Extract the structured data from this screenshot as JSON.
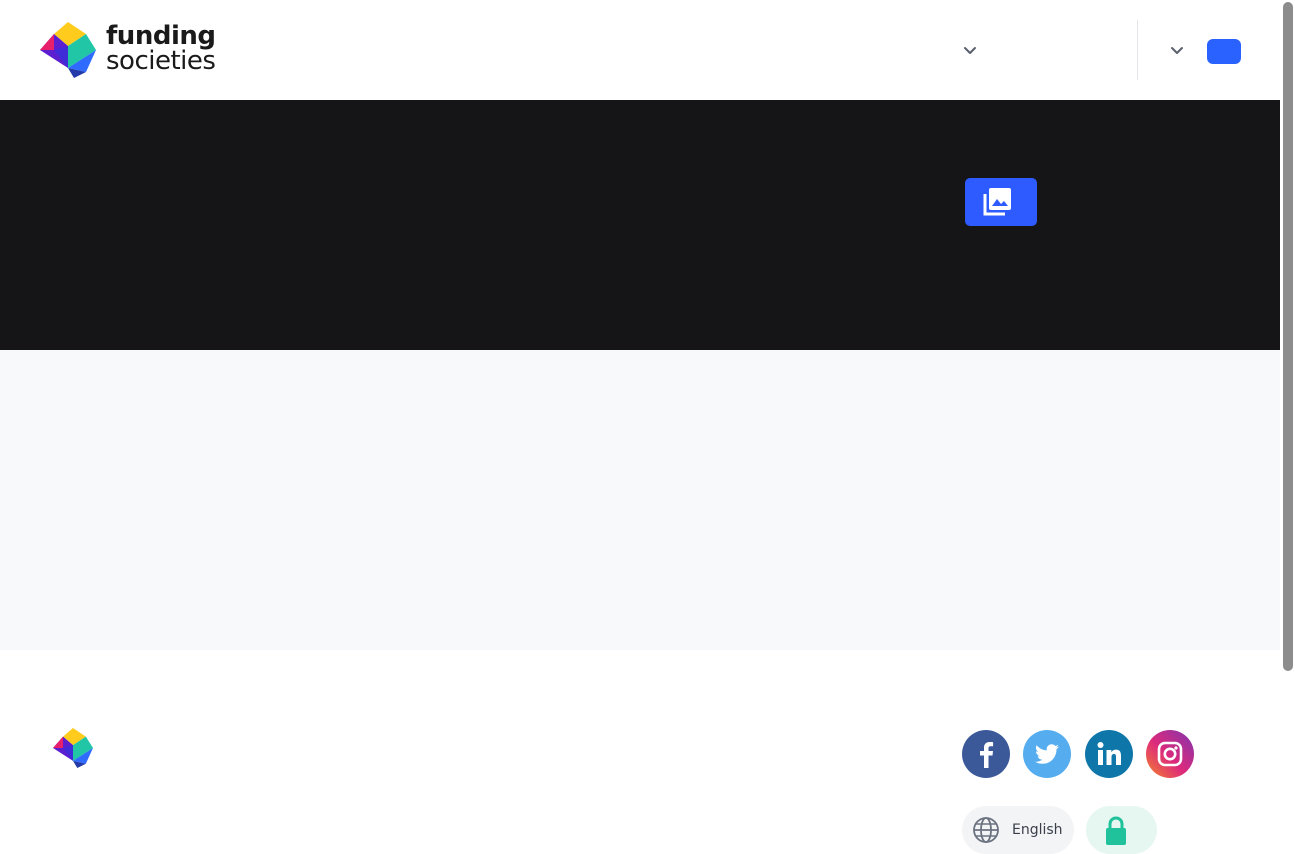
{
  "header": {
    "logo": {
      "line1": "funding",
      "line2": "societies"
    },
    "nav": {
      "dropdown_1_icon": "chevron-down-icon",
      "dropdown_2_icon": "chevron-down-icon",
      "cta_label": ""
    }
  },
  "hero": {
    "gallery_icon": "photo-library-icon"
  },
  "footer": {
    "social": [
      "facebook-icon",
      "twitter-icon",
      "linkedin-icon",
      "instagram-icon"
    ],
    "language_label": "English",
    "secure_icon": "lock-icon"
  },
  "colors": {
    "brand_blue": "#2962ff",
    "hero_bg": "#151517",
    "band_bg": "#f8f9fb",
    "facebook": "#3b5998",
    "twitter": "#55acee",
    "linkedin": "#0e76a8",
    "instagram": "#d6245a",
    "secure_green": "#1fc29a"
  }
}
